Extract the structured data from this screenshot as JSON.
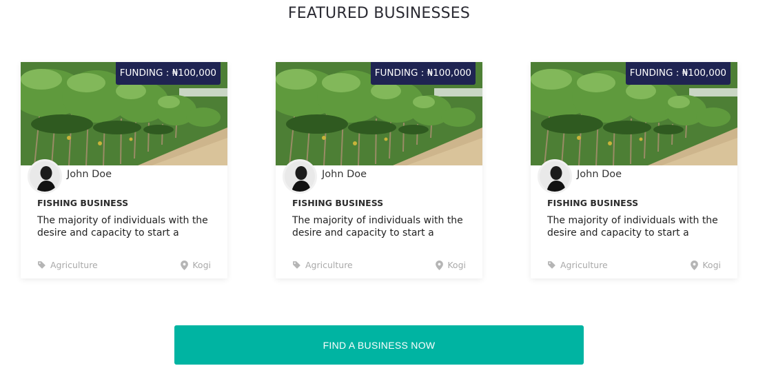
{
  "section": {
    "title": "FEATURED BUSINESSES"
  },
  "cards": [
    {
      "funding": "FUNDING : ₦100,000",
      "owner": "John Doe",
      "title": "FISHING BUSINESS",
      "description": "The majority of individuals with the desire and capacity to start a",
      "category": "Agriculture",
      "location": "Kogi"
    },
    {
      "funding": "FUNDING : ₦100,000",
      "owner": "John Doe",
      "title": "FISHING BUSINESS",
      "description": "The majority of individuals with the desire and capacity to start a",
      "category": "Agriculture",
      "location": "Kogi"
    },
    {
      "funding": "FUNDING : ₦100,000",
      "owner": "John Doe",
      "title": "FISHING BUSINESS",
      "description": "The majority of individuals with the desire and capacity to start a",
      "category": "Agriculture",
      "location": "Kogi"
    }
  ],
  "cta": {
    "label": "FIND A BUSINESS NOW"
  },
  "colors": {
    "badge": "#1f2452",
    "cta": "#00b4a2",
    "meta": "#a9a9a9"
  },
  "icons": {
    "category": "tag-icon",
    "location": "map-pin-icon"
  }
}
